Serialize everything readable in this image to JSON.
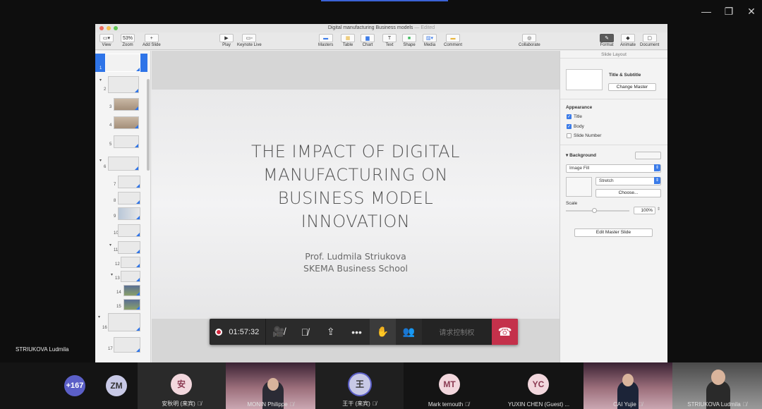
{
  "window": {
    "title": "Digital manufacturing Business models",
    "status": "— Edited"
  },
  "toolbar": {
    "view": "View",
    "zoom_value": "53%",
    "zoom": "Zoom",
    "add_slide": "Add Slide",
    "play": "Play",
    "keynote_live": "Keynote Live",
    "masters": "Masters",
    "table": "Table",
    "chart": "Chart",
    "text": "Text",
    "shape": "Shape",
    "media": "Media",
    "comment": "Comment",
    "collaborate": "Collaborate",
    "format": "Format",
    "animate": "Animate",
    "document": "Document"
  },
  "navigator": {
    "numbers": [
      "1",
      "2",
      "3",
      "4",
      "5",
      "6",
      "7",
      "8",
      "9",
      "10",
      "11",
      "12",
      "13",
      "14",
      "15",
      "16",
      "17"
    ]
  },
  "slide": {
    "title_lines": [
      "THE IMPACT OF DIGITAL",
      "MANUFACTURING ON",
      "BUSINESS MODEL",
      "INNOVATION"
    ],
    "subtitle_lines": [
      "Prof.  Ludmila Striukova",
      "SKEMA Business School"
    ]
  },
  "inspector": {
    "header": "Slide Layout",
    "layout_name": "Title & Subtitle",
    "change_master": "Change Master",
    "appearance": "Appearance",
    "title_chk": "Title",
    "body_chk": "Body",
    "slide_number_chk": "Slide Number",
    "background": "Background",
    "fill_type": "Image Fill",
    "stretch": "Stretch",
    "choose": "Choose...",
    "scale": "Scale",
    "scale_value": "100%",
    "edit_master": "Edit Master Slide"
  },
  "call": {
    "timer": "01:57:32",
    "request_control": "请求控制权",
    "presenter": "STRIUKOVA Ludmila"
  },
  "participants": {
    "overflow": "+167",
    "zm": "ZM",
    "p1_initial": "安",
    "p1_name": "安秋明 (来宾)",
    "p2_name": "MONIN Philippe",
    "p3_initial": "王",
    "p3_name": "王干 (来宾)",
    "p4_initial": "MT",
    "p4_name": "Mark ternouth",
    "p5_initial": "YC",
    "p5_name": "YUXIN CHEN (Guest) ...",
    "p6_name": "CAI Yujie",
    "p7_name": "STRIUKOVA Ludmila"
  },
  "colors": {
    "accent": "#2e74e8",
    "hangup": "#c4314b",
    "record": "#d2263c"
  }
}
